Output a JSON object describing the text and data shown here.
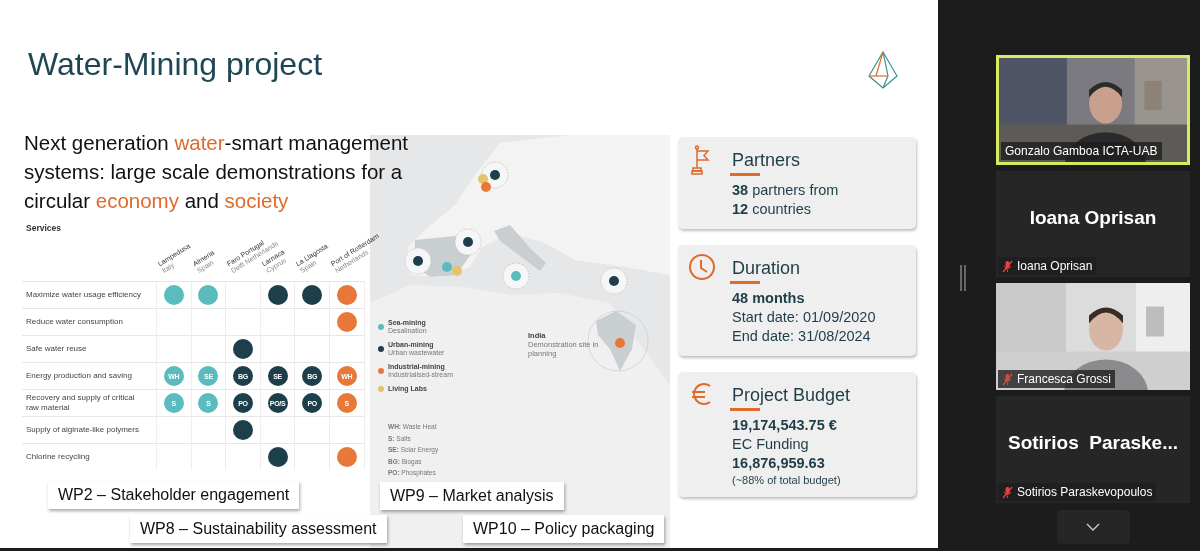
{
  "slide": {
    "title": "Water-Mining project",
    "subtitle": [
      {
        "text": "Next generation ",
        "accent": false
      },
      {
        "text": "water",
        "accent": true
      },
      {
        "text": "-smart management systems: large scale demonstrations for a circular ",
        "accent": false
      },
      {
        "text": "economy",
        "accent": true
      },
      {
        "text": " and ",
        "accent": false
      },
      {
        "text": "society",
        "accent": true
      }
    ],
    "services_table": {
      "header": "Services",
      "columns": [
        {
          "name": "Lampedusa",
          "sub": "Italy"
        },
        {
          "name": "Almeria",
          "sub": "Spain"
        },
        {
          "name": "Faro Portugal",
          "sub": "Delft Netherlands"
        },
        {
          "name": "Larnaca",
          "sub": "Cyprus"
        },
        {
          "name": "La Llagosta",
          "sub": "Spain"
        },
        {
          "name": "Port of Rotterdam",
          "sub": "Netherlands"
        }
      ],
      "rows": [
        {
          "service": "Maximize water usage efficiency",
          "cells": [
            {
              "kind": "dot",
              "color": "#5bbcc0"
            },
            {
              "kind": "dot",
              "color": "#5bbcc0"
            },
            {
              "kind": "empty"
            },
            {
              "kind": "dot",
              "color": "#1d3f4c"
            },
            {
              "kind": "dot",
              "color": "#1d3f4c"
            },
            {
              "kind": "dot",
              "color": "#e8773a"
            }
          ]
        },
        {
          "service": "Reduce water consumption",
          "cells": [
            {
              "kind": "empty"
            },
            {
              "kind": "empty"
            },
            {
              "kind": "empty"
            },
            {
              "kind": "empty"
            },
            {
              "kind": "empty"
            },
            {
              "kind": "dot",
              "color": "#e8773a"
            }
          ]
        },
        {
          "service": "Safe water reuse",
          "cells": [
            {
              "kind": "empty"
            },
            {
              "kind": "empty"
            },
            {
              "kind": "dot",
              "color": "#1d3f4c"
            },
            {
              "kind": "empty"
            },
            {
              "kind": "empty"
            },
            {
              "kind": "empty"
            }
          ]
        },
        {
          "service": "Energy production and saving",
          "cells": [
            {
              "kind": "dot",
              "color": "#5bbcc0",
              "label": "WH"
            },
            {
              "kind": "dot",
              "color": "#5bbcc0",
              "label": "SE"
            },
            {
              "kind": "dot",
              "color": "#1d3f4c",
              "label": "BG"
            },
            {
              "kind": "dot",
              "color": "#1d3f4c",
              "label": "SE"
            },
            {
              "kind": "dot",
              "color": "#1d3f4c",
              "label": "BG"
            },
            {
              "kind": "dot",
              "color": "#e8773a",
              "label": "WH"
            }
          ]
        },
        {
          "service": "Recovery and supply of critical raw material",
          "cells": [
            {
              "kind": "dot",
              "color": "#5bbcc0",
              "label": "S"
            },
            {
              "kind": "dot",
              "color": "#5bbcc0",
              "label": "S"
            },
            {
              "kind": "dot",
              "color": "#1d3f4c",
              "label": "PO"
            },
            {
              "kind": "dot",
              "color": "#1d3f4c",
              "label": "PO/S"
            },
            {
              "kind": "dot",
              "color": "#1d3f4c",
              "label": "PO"
            },
            {
              "kind": "dot",
              "color": "#e8773a",
              "label": "S"
            }
          ]
        },
        {
          "service": "Supply of alginate-like polymers",
          "cells": [
            {
              "kind": "empty"
            },
            {
              "kind": "empty"
            },
            {
              "kind": "dot",
              "color": "#1d3f4c"
            },
            {
              "kind": "empty"
            },
            {
              "kind": "empty"
            },
            {
              "kind": "empty"
            }
          ]
        },
        {
          "service": "Chlorine recycling",
          "cells": [
            {
              "kind": "empty"
            },
            {
              "kind": "empty"
            },
            {
              "kind": "empty"
            },
            {
              "kind": "dot",
              "color": "#1d3f4c"
            },
            {
              "kind": "empty"
            },
            {
              "kind": "dot",
              "color": "#e8773a"
            }
          ]
        }
      ]
    },
    "map": {
      "legend": [
        {
          "name": "Sea-mining",
          "desc": "Desalination",
          "color": "#5bbcc0"
        },
        {
          "name": "Urban-mining",
          "desc": "Urban wastewater",
          "color": "#1d3f4c"
        },
        {
          "name": "Industrial-mining",
          "desc": "Industrialised-stream",
          "color": "#e8773a"
        },
        {
          "name": "Living Labs",
          "color": "#e3c46a"
        }
      ],
      "abbreviations": [
        "**WH:** Waste Heat",
        "**S:** Salts",
        "**SE:** Solar Energy",
        "**BG:** Biogas",
        "**PO:** Phosphates"
      ],
      "note": {
        "title": "India",
        "text": "Demonstration site in planning"
      }
    },
    "cards": [
      {
        "kind": "partners",
        "title": "Partners",
        "lines": [
          {
            "kind": "plain",
            "text": "**38** partners from"
          },
          {
            "kind": "plain",
            "text": "**12** countries"
          }
        ]
      },
      {
        "kind": "duration",
        "title": "Duration",
        "lines": [
          {
            "kind": "figure",
            "text": "48 months"
          },
          {
            "kind": "plain",
            "text": "Start date: 01/09/2020"
          },
          {
            "kind": "plain",
            "text": "End date: 31/08/2024"
          }
        ]
      },
      {
        "kind": "budget",
        "title": "Project Budget",
        "lines": [
          {
            "kind": "figure",
            "text": "19,174,543.75 €"
          },
          {
            "kind": "plain",
            "text": "EC Funding"
          },
          {
            "kind": "figure",
            "text": "16,876,959.63"
          },
          {
            "kind": "note",
            "text": "(~88% of total budget)"
          }
        ]
      }
    ],
    "work_packages": [
      "WP2 – Stakeholder engagement",
      "WP9 – Market analysis",
      "WP8 – Sustainability assessment",
      "WP10 – Policy packaging"
    ]
  },
  "participants": [
    {
      "kind": "video",
      "name": "Gonzalo Gamboa ICTA-UAB",
      "muted": false,
      "active_speaker": true
    },
    {
      "kind": "avatar",
      "display_name": "Ioana Oprisan",
      "name": "Ioana Oprisan",
      "muted": true,
      "active_speaker": false
    },
    {
      "kind": "video",
      "name": "Francesca Grossi",
      "muted": true,
      "active_speaker": false
    },
    {
      "kind": "avatar",
      "display_name": "Sotirios  Paraske...",
      "name": "Sotirios Paraskevopoulos",
      "muted": true,
      "active_speaker": false
    }
  ]
}
